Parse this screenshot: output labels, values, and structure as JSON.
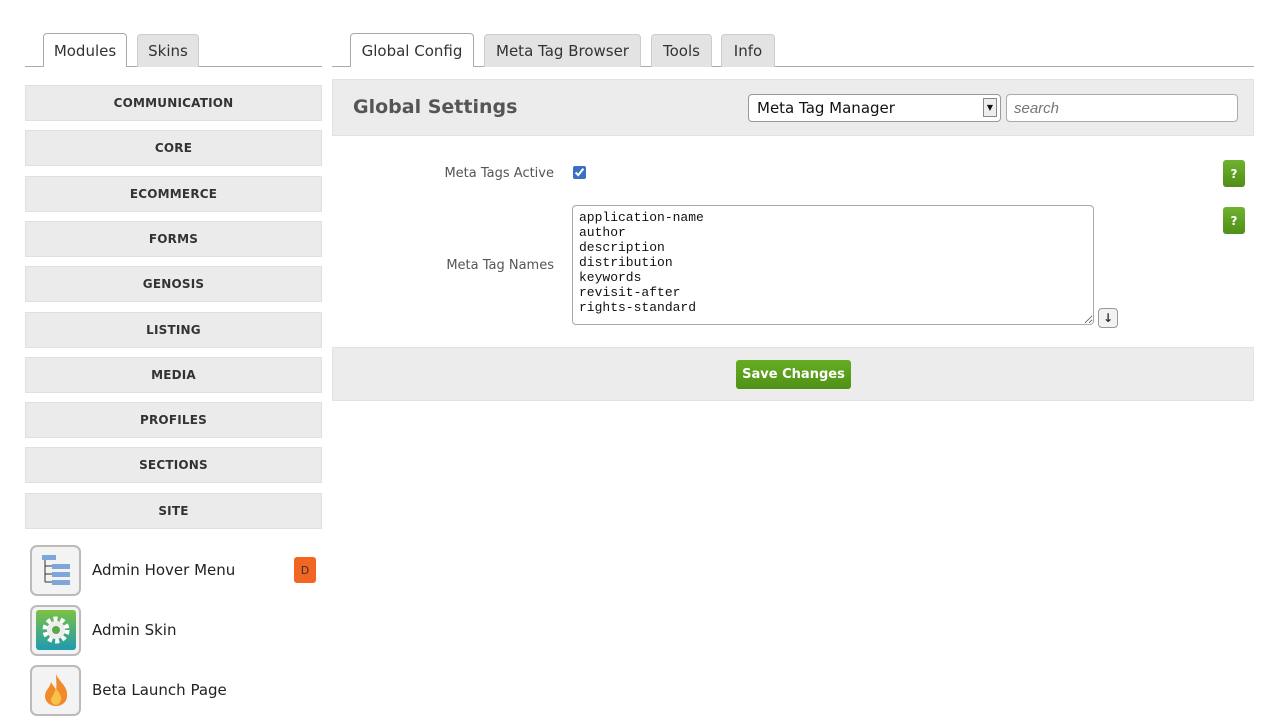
{
  "left_tabs": [
    {
      "label": "Modules",
      "active": true
    },
    {
      "label": "Skins",
      "active": false
    }
  ],
  "main_tabs": [
    {
      "label": "Global Config",
      "active": true
    },
    {
      "label": "Meta Tag Browser"
    },
    {
      "label": "Tools"
    },
    {
      "label": "Info"
    }
  ],
  "modules": [
    "COMMUNICATION",
    "CORE",
    "ECOMMERCE",
    "FORMS",
    "GENOSIS",
    "LISTING",
    "MEDIA",
    "PROFILES",
    "SECTIONS",
    "SITE"
  ],
  "items": [
    {
      "label": "Admin Hover Menu",
      "icon": "hover-menu-icon",
      "badge": "D"
    },
    {
      "label": "Admin Skin",
      "icon": "gear-icon"
    },
    {
      "label": "Beta Launch Page",
      "icon": "flame-icon"
    }
  ],
  "header": {
    "title": "Global Settings",
    "select_value": "Meta Tag Manager",
    "search_placeholder": "search"
  },
  "form": {
    "active_label": "Meta Tags Active",
    "active_checked": true,
    "names_label": "Meta Tag Names",
    "names_value": "application-name\nauthor\ndescription\ndistribution\nkeywords\nrevisit-after\nrights-standard",
    "help": "?"
  },
  "footer": {
    "save_label": "Save Changes"
  },
  "colors": {
    "accent": "#5a9e1e",
    "badge": "#f26522"
  }
}
